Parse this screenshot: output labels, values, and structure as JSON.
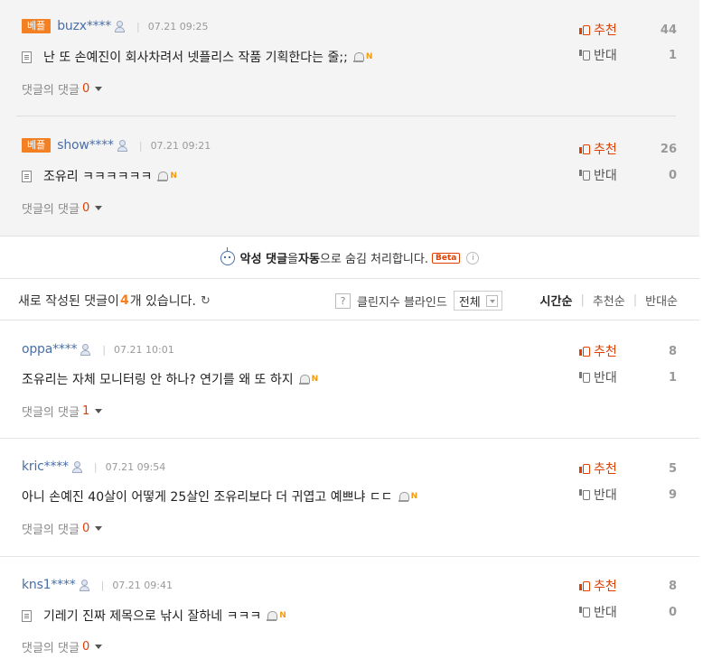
{
  "best_comments": [
    {
      "badge": "베플",
      "nickname": "buzx****",
      "date": "07.21 09:25",
      "text": "난 또 손예진이 회사차려서 넷플리스 작품 기획한다는 줄;;",
      "reply_label": "댓글의 댓글",
      "reply_count": "0",
      "up_label": "추천",
      "up_count": "44",
      "down_label": "반대",
      "down_count": "1"
    },
    {
      "badge": "베플",
      "nickname": "show****",
      "date": "07.21 09:21",
      "text": "조유리 ㅋㅋㅋㅋㅋㅋ",
      "reply_label": "댓글의 댓글",
      "reply_count": "0",
      "up_label": "추천",
      "up_count": "26",
      "down_label": "반대",
      "down_count": "0"
    }
  ],
  "notice": {
    "prefix": "악성 댓글",
    "middle1": "을 ",
    "bold2": "자동",
    "middle2": "으로 숨김 처리합니다.",
    "beta": "Beta",
    "info": "i"
  },
  "toolbar": {
    "new_prefix": "새로 작성된 댓글이 ",
    "new_count": "4",
    "new_suffix": "개 있습니다.",
    "refresh_icon": "↻",
    "help_icon": "?",
    "clean_label": "클린지수 블라인드",
    "filter_value": "전체",
    "sort_tabs": [
      "시간순",
      "추천순",
      "반대순"
    ]
  },
  "comments": [
    {
      "nickname": "oppa****",
      "date": "07.21 10:01",
      "text": "조유리는 자체 모니터링 안 하나? 연기를 왜 또 하지",
      "reply_label": "댓글의 댓글",
      "reply_count": "1",
      "up_label": "추천",
      "up_count": "8",
      "down_label": "반대",
      "down_count": "1"
    },
    {
      "nickname": "kric****",
      "date": "07.21 09:54",
      "text": "아니 손예진 40살이 어떻게 25살인 조유리보다 더 귀엽고 예쁘냐 ㄷㄷ",
      "reply_label": "댓글의 댓글",
      "reply_count": "0",
      "up_label": "추천",
      "up_count": "5",
      "down_label": "반대",
      "down_count": "9"
    },
    {
      "nickname": "kns1****",
      "date": "07.21 09:41",
      "text": "기레기 진짜 제목으로 낚시 잘하네 ㅋㅋㅋ",
      "reply_label": "댓글의 댓글",
      "reply_count": "0",
      "up_label": "추천",
      "up_count": "8",
      "down_label": "반대",
      "down_count": "0"
    }
  ],
  "n_icon_text": "N",
  "colors": {
    "accent": "#f48024",
    "up": "#e13f00",
    "nickname": "#4a6ea8",
    "best_bg": "#f4f4f4"
  }
}
